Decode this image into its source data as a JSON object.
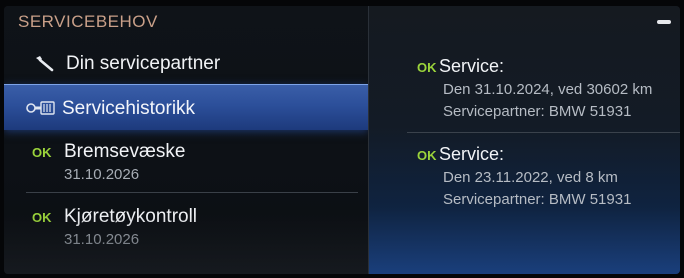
{
  "header": {
    "title": "SERVICEBEHOV"
  },
  "menu": {
    "partner_label": "Din servicepartner",
    "history_label": "Servicehistorikk",
    "items": [
      {
        "status": "OK",
        "label": "Bremsevæske",
        "date": "31.10.2026"
      },
      {
        "status": "OK",
        "label": "Kjøretøykontroll",
        "date": "31.10.2026"
      }
    ]
  },
  "services": [
    {
      "status": "OK",
      "title": "Service:",
      "line1": "Den 31.10.2024, ved 30602 km",
      "line2": "Servicepartner: BMW 51931"
    },
    {
      "status": "OK",
      "title": "Service:",
      "line1": "Den 23.11.2022, ved 8 km",
      "line2": "Servicepartner: BMW 51931"
    }
  ],
  "colors": {
    "header": "#c9a089",
    "ok": "#9bd43b",
    "selected": "#2c4f9a"
  },
  "icons": {
    "partner": "wrench-icon",
    "history": "service-key-icon"
  }
}
